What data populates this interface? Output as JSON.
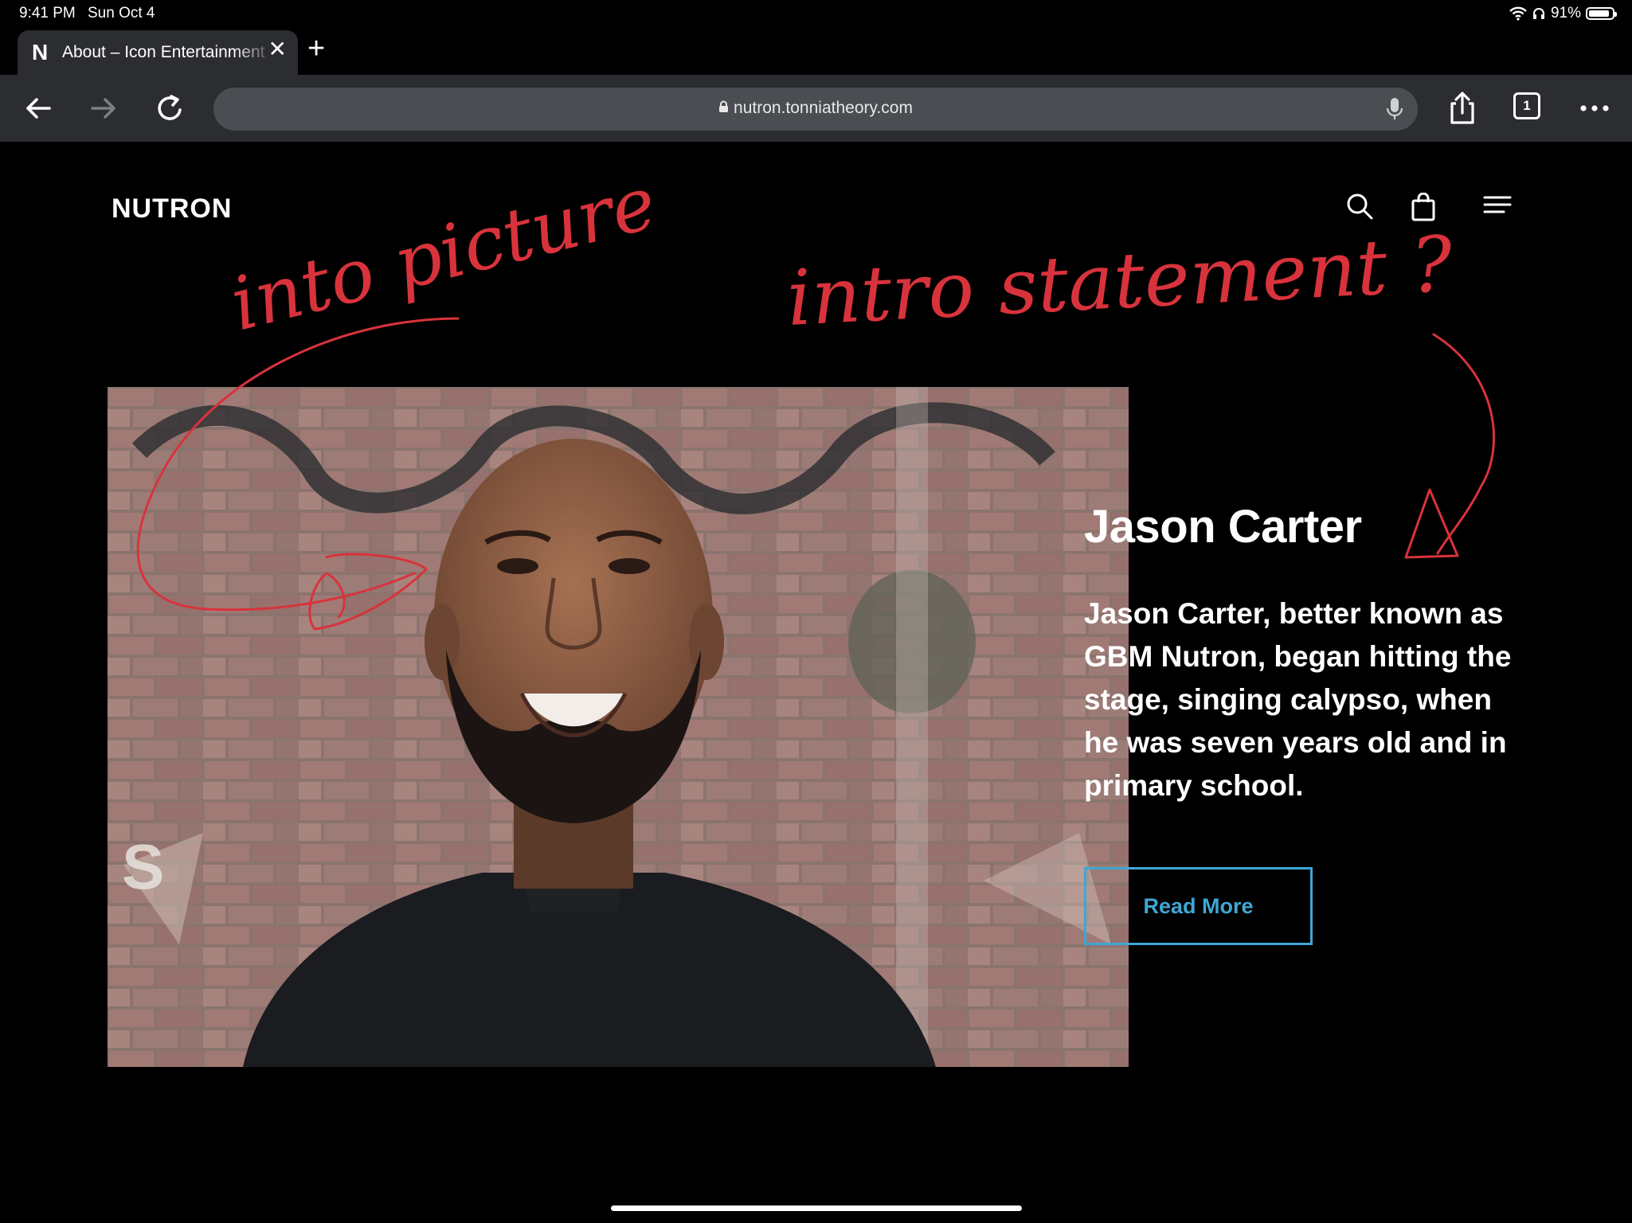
{
  "status_bar": {
    "time": "9:41 PM",
    "date": "Sun Oct 4",
    "battery": "91%",
    "battery_level": 0.91
  },
  "tab": {
    "favicon": "N",
    "title": "About – Icon Entertainment",
    "icon_close": "close-icon",
    "icon_new": "plus-icon"
  },
  "toolbar": {
    "url": "nutron.tonniatheory.com",
    "tab_count": "1",
    "icons": [
      "back-arrow-icon",
      "forward-arrow-icon",
      "reload-icon",
      "lock-icon",
      "microphone-icon",
      "share-icon",
      "tabs-icon",
      "more-icon"
    ]
  },
  "site": {
    "logo": "NUTRON",
    "nav_icons": [
      "search-icon",
      "shopping-bag-icon",
      "hamburger-menu-icon"
    ]
  },
  "hero": {
    "name": "Jason Carter",
    "bio": "Jason Carter, better known as GBM Nutron, began hitting the stage, singing calypso, when he was seven years old and in primary school.",
    "cta": "Read More",
    "accent_color": "#3ea7d6"
  },
  "annotations": {
    "note1": "into picture",
    "note2": "intro statement ?",
    "ink_color": "#d8333c"
  }
}
